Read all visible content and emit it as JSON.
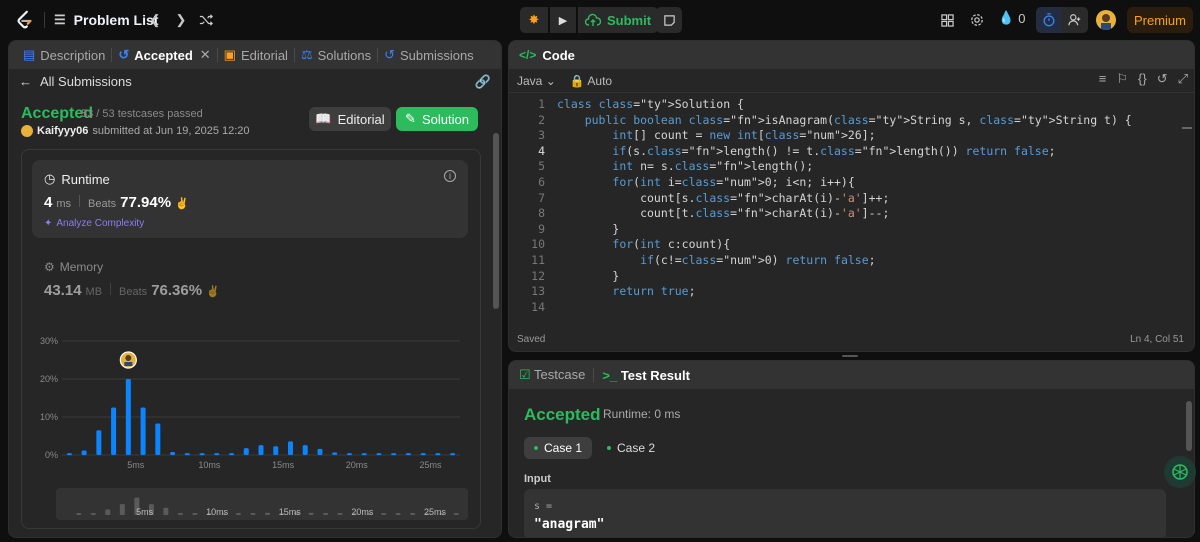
{
  "topbar": {
    "problem_list": "Problem List",
    "submit": "Submit",
    "fire_count": "0",
    "premium": "Premium"
  },
  "left": {
    "tabs": [
      {
        "label": "Description"
      },
      {
        "label": "Accepted"
      },
      {
        "label": "Editorial"
      },
      {
        "label": "Solutions"
      },
      {
        "label": "Submissions"
      }
    ],
    "all_submissions": "All Submissions",
    "status": "Accepted",
    "testcases": "53 / 53 testcases passed",
    "user": "Kaifyyy06",
    "submitted_at": "submitted at Jun 19, 2025 12:20",
    "editorial_btn": "Editorial",
    "solution_btn": "Solution",
    "runtime": {
      "label": "Runtime",
      "value": "4",
      "unit": "ms",
      "beats_label": "Beats",
      "beats": "77.94%",
      "analyze": "Analyze Complexity"
    },
    "memory": {
      "label": "Memory",
      "value": "43.14",
      "unit": "MB",
      "beats_label": "Beats",
      "beats": "76.36%"
    }
  },
  "chart_data": {
    "type": "bar",
    "title": "",
    "xlabel": "",
    "ylabel": "",
    "ylim": [
      0,
      30
    ],
    "yticks": [
      "30%",
      "20%",
      "10%",
      "0%"
    ],
    "xticks": [
      "5ms",
      "10ms",
      "15ms",
      "20ms",
      "25ms"
    ],
    "x": [
      0,
      1,
      2,
      3,
      4,
      5,
      6,
      7,
      8,
      9,
      10,
      11,
      12,
      13,
      14,
      15,
      16,
      17,
      18,
      19,
      20,
      21,
      22,
      23,
      24,
      25,
      26
    ],
    "values": [
      0.5,
      1.2,
      6.5,
      12.5,
      20,
      12.5,
      8.3,
      0.8,
      0.5,
      0.5,
      0.5,
      0.5,
      1.8,
      2.6,
      2.3,
      3.6,
      2.6,
      1.6,
      0.7,
      0.5,
      0.5,
      0.5,
      0.5,
      0.5,
      0.5,
      0.5,
      0.5
    ],
    "highlight_index": 4,
    "colors": {
      "bar": "#0a84ff",
      "grid": "#3a3a3a",
      "tick": "#8a8a8a"
    }
  },
  "mini_chart": {
    "xticks": [
      "5ms",
      "10ms",
      "15ms",
      "20ms",
      "25ms"
    ]
  },
  "code": {
    "title": "Code",
    "language": "Java",
    "mode": "Auto",
    "status": "Saved",
    "position": "Ln 4, Col 51",
    "lines": [
      "class Solution {",
      "    public boolean isAnagram(String s, String t) {",
      "        int[] count = new int[26];",
      "        if(s.length() != t.length()) return false;",
      "        int n= s.length();",
      "        for(int i=0; i<n; i++){",
      "            count[s.charAt(i)-'a']++;",
      "            count[t.charAt(i)-'a']--;",
      "        }",
      "        for(int c:count){",
      "            if(c!=0) return false;",
      "        }",
      "        return true;",
      ""
    ]
  },
  "test": {
    "tab_testcase": "Testcase",
    "tab_result": "Test Result",
    "status": "Accepted",
    "runtime": "Runtime: 0 ms",
    "case1": "Case 1",
    "case2": "Case 2",
    "input_label": "Input",
    "var": "s =",
    "value": "\"anagram\""
  }
}
